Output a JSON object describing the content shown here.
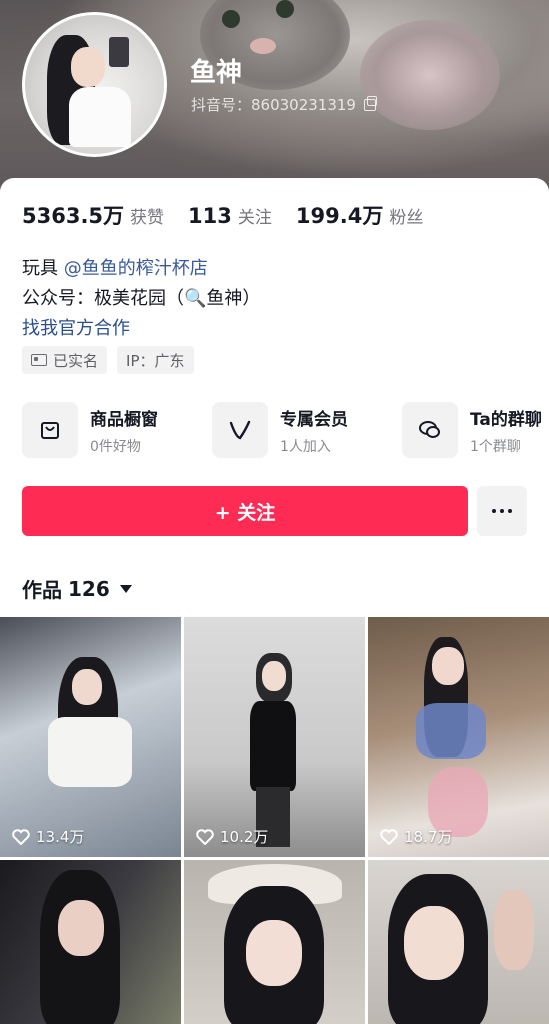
{
  "profile": {
    "username": "鱼神",
    "douyin_id": "抖音号：86030231319"
  },
  "stats": [
    {
      "value": "5363.5万",
      "label": "获赞"
    },
    {
      "value": "113",
      "label": "关注"
    },
    {
      "value": "199.4万",
      "label": "粉丝"
    }
  ],
  "bio": {
    "line1_prefix": "玩具",
    "line1_mention": "@鱼鱼的榨汁杯店",
    "line2": "公众号：极美花园（🔍鱼神）",
    "link": "找我官方合作"
  },
  "tags": {
    "verified": "已实名",
    "ip": "IP：广东"
  },
  "services": [
    {
      "title": "商品橱窗",
      "subtitle": "0件好物",
      "icon": "bag-icon"
    },
    {
      "title": "专属会员",
      "subtitle": "1人加入",
      "icon": "v-icon"
    },
    {
      "title": "Ta的群聊",
      "subtitle": "1个群聊",
      "icon": "chat-icon"
    }
  ],
  "actions": {
    "follow_label": "+ 关注",
    "more_label": "more"
  },
  "works": {
    "title": "作品",
    "count": "126"
  },
  "videos": [
    {
      "likes": "13.4万"
    },
    {
      "likes": "10.2万"
    },
    {
      "likes": "18.7万"
    },
    {
      "likes": ""
    },
    {
      "likes": ""
    },
    {
      "likes": ""
    }
  ],
  "colors": {
    "accent": "#fe2c55",
    "link": "#2c4f8c",
    "secondary_text": "#75767e"
  }
}
